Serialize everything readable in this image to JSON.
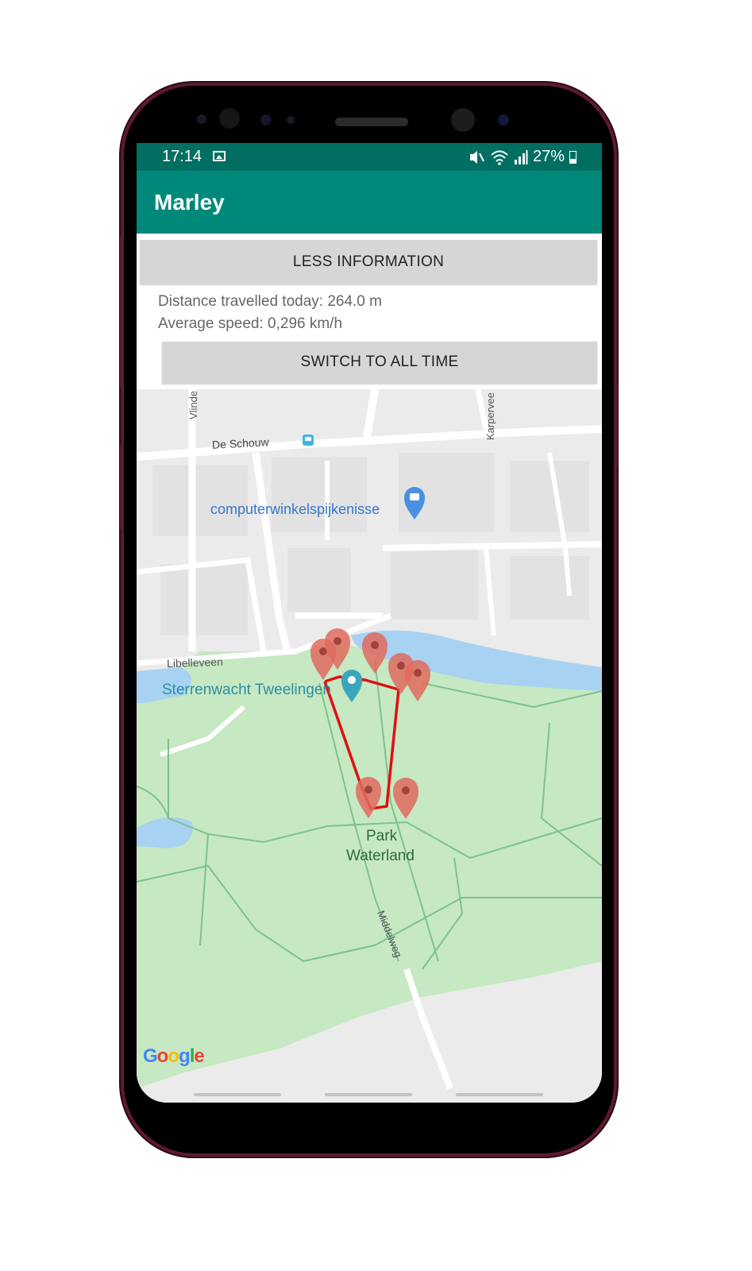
{
  "status_bar": {
    "time": "17:14",
    "right_text": "27%",
    "icons": [
      "image-icon",
      "mute-icon",
      "wifi-icon",
      "signal-icon",
      "battery-icon"
    ]
  },
  "app_bar": {
    "title": "Marley",
    "color": "#00897b",
    "status_color": "#006f62"
  },
  "info_panel": {
    "toggle_button": "LESS INFORMATION",
    "distance": "Distance travelled today: 264.0 m",
    "speed": "Average speed: 0,296 km/h",
    "switch_button": "SWITCH TO ALL TIME"
  },
  "map": {
    "labels": {
      "street_vlinder": "Vlinde",
      "street_schouw": "De Schouw",
      "street_karper": "Karpervee",
      "shop": "computerwinkelspijkenisse",
      "street_libelle": "Libelleveen",
      "observatory": "Sterrenwacht Tweelingen",
      "park_line1": "Park",
      "park_line2": "Waterland",
      "street_middel": "Middelweg"
    },
    "google_logo": "Google",
    "route_color": "#e01010",
    "marker_color": "#e06a5e",
    "park_color": "#c6e8c2",
    "water_color": "#a8d2f2"
  }
}
